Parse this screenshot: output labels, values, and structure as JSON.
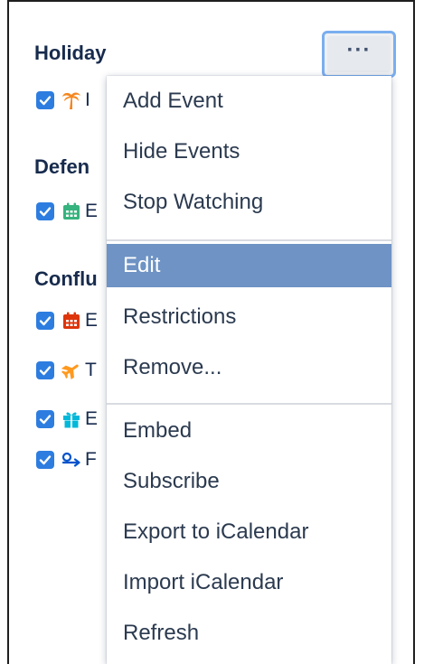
{
  "sections": [
    {
      "heading": "Holiday",
      "calendars": [
        {
          "name": "I",
          "checked": true,
          "icon": "palm-tree-icon",
          "icon_color": "#f5871f"
        }
      ]
    },
    {
      "heading": "Defen",
      "calendars": [
        {
          "name": "E",
          "checked": true,
          "icon": "calendar-icon",
          "icon_color": "#36b37e"
        }
      ]
    },
    {
      "heading": "Conflu",
      "calendars": [
        {
          "name": "E",
          "checked": true,
          "icon": "calendar-icon",
          "icon_color": "#de350b"
        },
        {
          "name": "T",
          "checked": true,
          "icon": "airplane-icon",
          "icon_color": "#ff991f"
        },
        {
          "name": "E",
          "checked": true,
          "icon": "gift-icon",
          "icon_color": "#00b8d9"
        },
        {
          "name": "F",
          "checked": true,
          "icon": "travel-route-icon",
          "icon_color": "#0052cc"
        }
      ]
    }
  ],
  "more_button": {
    "label": "···"
  },
  "menu": {
    "groups": [
      [
        {
          "label": "Add Event"
        },
        {
          "label": "Hide Events"
        },
        {
          "label": "Stop Watching"
        }
      ],
      [
        {
          "label": "Edit",
          "active": true
        },
        {
          "label": "Restrictions"
        },
        {
          "label": "Remove..."
        }
      ],
      [
        {
          "label": "Embed"
        },
        {
          "label": "Subscribe"
        },
        {
          "label": "Export to iCalendar"
        },
        {
          "label": "Import iCalendar"
        },
        {
          "label": "Refresh"
        }
      ]
    ]
  },
  "colors": {
    "checkbox": "#2d7de0",
    "menu_active": "#6e93c4",
    "focus_ring": "#7aaef0"
  }
}
